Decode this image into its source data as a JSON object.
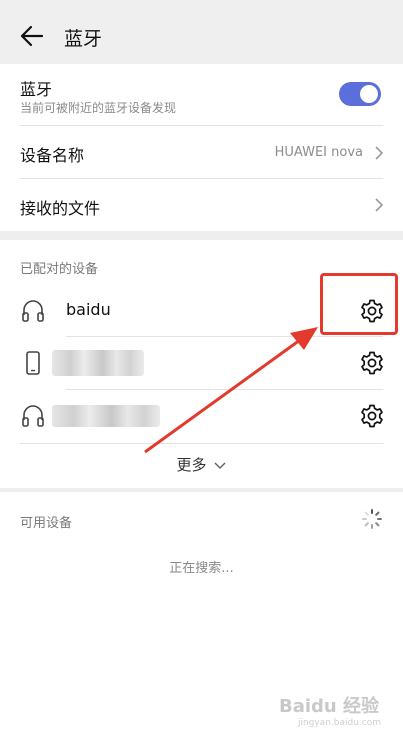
{
  "header": {
    "title": "蓝牙",
    "back_icon": "arrow-left-icon"
  },
  "bluetooth": {
    "title": "蓝牙",
    "subtitle": "当前可被附近的蓝牙设备发现",
    "enabled": true,
    "accent_color": "#5b6fdc"
  },
  "device_name": {
    "label": "设备名称",
    "value": "HUAWEI nova"
  },
  "received_files": {
    "label": "接收的文件"
  },
  "paired": {
    "title": "已配对的设备",
    "devices": [
      {
        "name": "baidu",
        "icon": "headphones-icon"
      },
      {
        "name": "",
        "icon": "phone-icon"
      },
      {
        "name": "",
        "icon": "headphones-icon"
      }
    ],
    "more_label": "更多"
  },
  "available": {
    "title": "可用设备",
    "status": "正在搜索..."
  },
  "annotation": {
    "color": "#e33a2e"
  },
  "watermark": {
    "text": "Baidu 经验",
    "sub": "jingyan.baidu.com"
  }
}
